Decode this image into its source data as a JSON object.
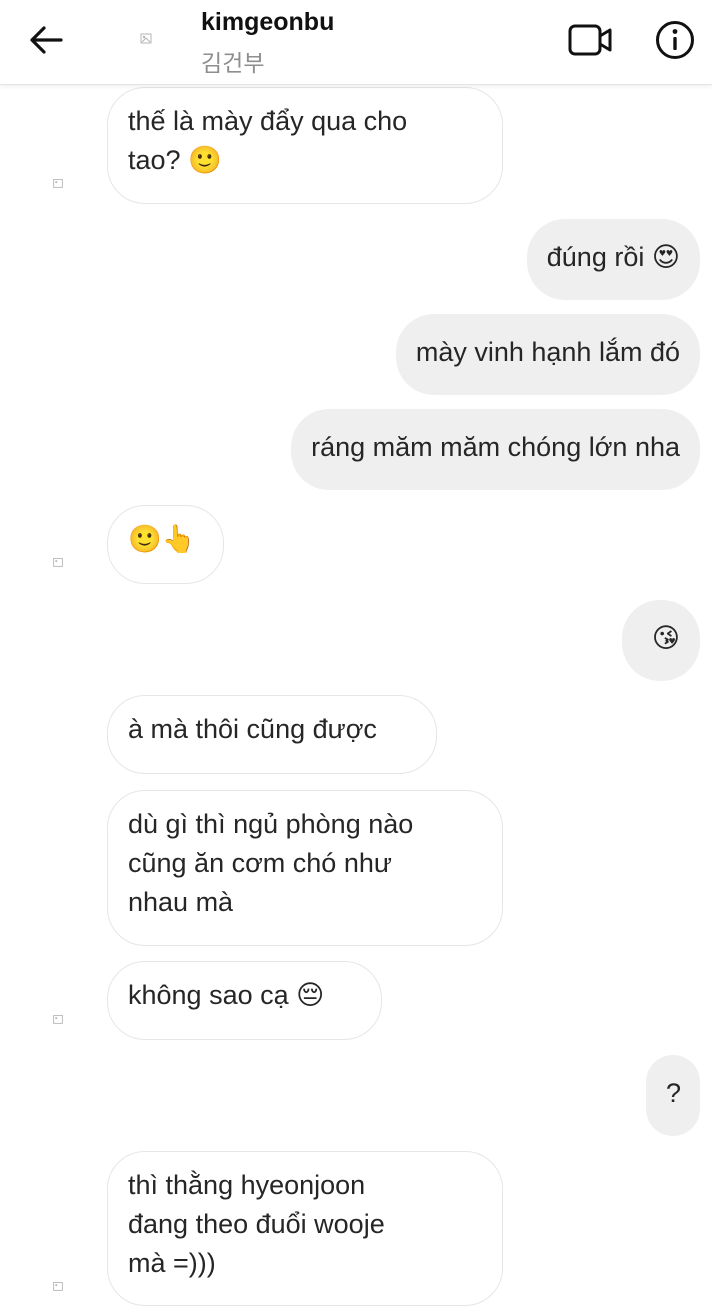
{
  "header": {
    "username": "kimgeonbu",
    "fullname": "김건부"
  },
  "messages": [
    {
      "dir": "in",
      "text": "thế là mày đẩy qua cho\ntao? 🙂"
    },
    {
      "dir": "out",
      "text": "đúng rồi 😍"
    },
    {
      "dir": "out",
      "text": "mày vinh hạnh lắm đó"
    },
    {
      "dir": "out",
      "text": "ráng măm măm chóng lớn nha"
    },
    {
      "dir": "in",
      "text": "🙂👆"
    },
    {
      "dir": "out",
      "text": "😘"
    },
    {
      "dir": "in",
      "text": "à mà thôi cũng được"
    },
    {
      "dir": "in",
      "text": "dù gì thì ngủ phòng nào\ncũng ăn cơm chó như\nnhau mà"
    },
    {
      "dir": "in",
      "text": "không sao cạ 😔"
    },
    {
      "dir": "out",
      "text": "?"
    },
    {
      "dir": "in",
      "text": "thì thằng hyeonjoon\nđang theo đuổi wooje\nmà =)))"
    }
  ],
  "icons": {
    "back": "arrow-left-icon",
    "video": "video-camera-icon",
    "info": "info-icon",
    "avatar": "avatar-icon"
  }
}
